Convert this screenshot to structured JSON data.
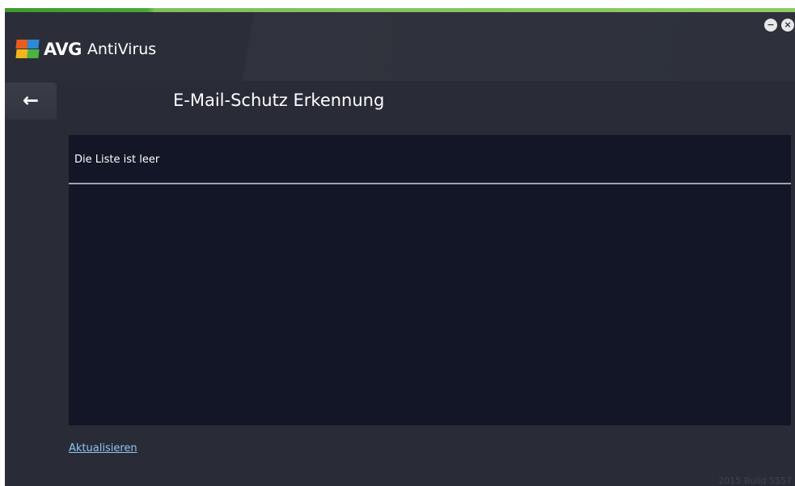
{
  "app": {
    "brand": "AVG",
    "product": "AntiVirus"
  },
  "window_controls": {
    "minimize_symbol": "−",
    "close_symbol": "×"
  },
  "header": {
    "back_symbol": "←",
    "title": "E-Mail-Schutz Erkennung"
  },
  "list": {
    "empty_message": "Die Liste ist leer"
  },
  "footer": {
    "refresh_link": "Aktualisieren",
    "version": "2015 Build 5557"
  },
  "colors": {
    "background": "#292c36",
    "panel": "#121626",
    "accent_green": "#4aa838",
    "link": "#8fc6f5"
  },
  "icons": {
    "logo": "avg-logo-icon",
    "back": "back-arrow-icon",
    "minimize": "minimize-icon",
    "close": "close-icon"
  }
}
